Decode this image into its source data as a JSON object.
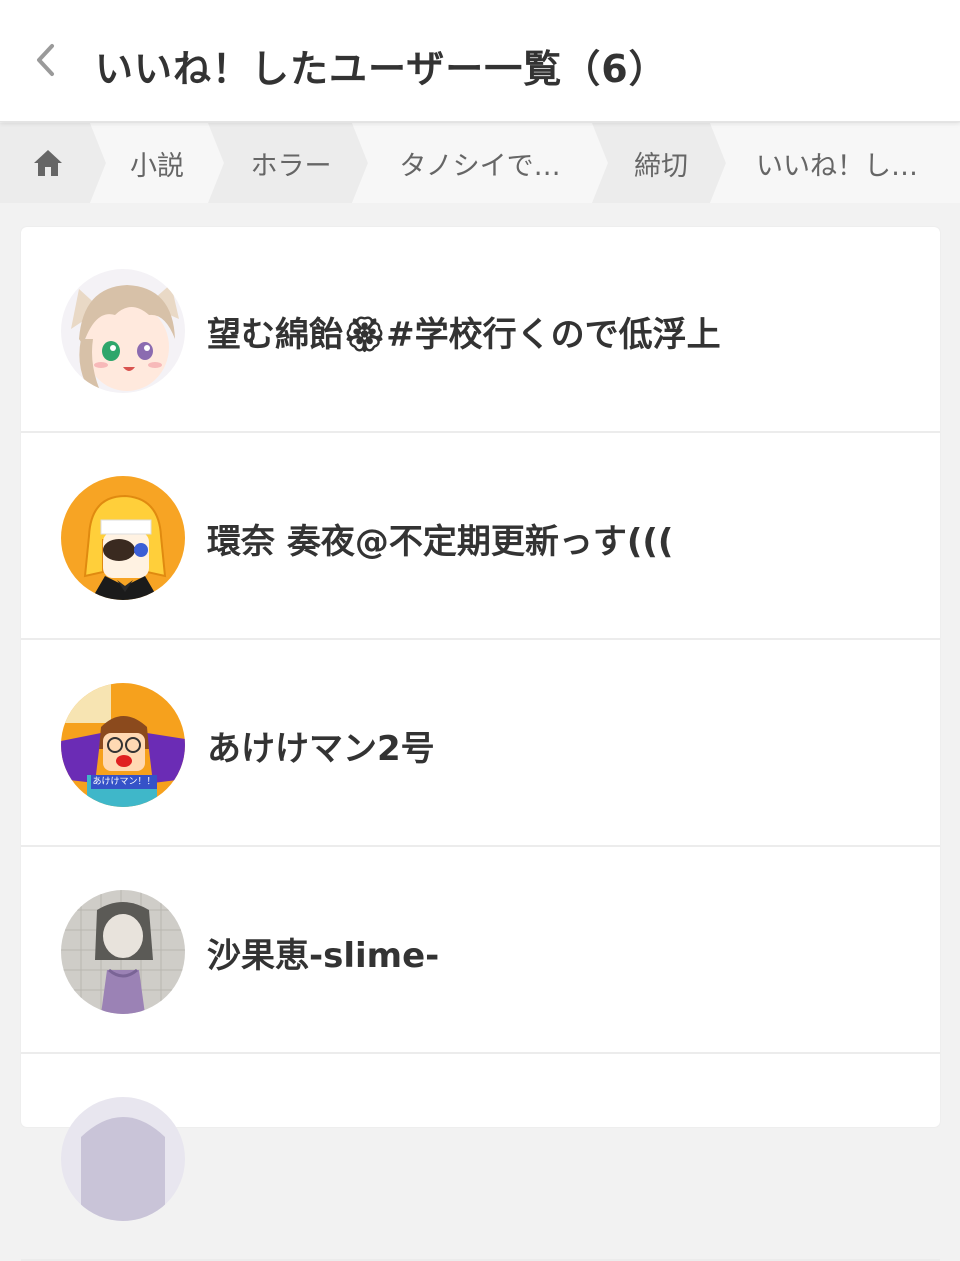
{
  "header": {
    "title": "いいね！したユーザー一覧（6）"
  },
  "breadcrumb": {
    "items": [
      {
        "label": "",
        "icon": "home-icon"
      },
      {
        "label": "小説"
      },
      {
        "label": "ホラー"
      },
      {
        "label": "タノシイで…"
      },
      {
        "label": "締切"
      },
      {
        "label": "いいね！し…"
      }
    ]
  },
  "users": [
    {
      "name": "望む綿飴🏵#学校行くので低浮上"
    },
    {
      "name": "環奈 奏夜@不定期更新っす((("
    },
    {
      "name": "あけけマン2号",
      "avatar_caption": "あけけマン！！"
    },
    {
      "name": "沙果恵-slime-"
    },
    {
      "name": ""
    }
  ],
  "colors": {
    "header_bg": "#ffffff",
    "breadcrumb_bg": "#f7f7f7",
    "breadcrumb_alt_bg": "#ececec",
    "text": "#333333",
    "muted": "#666666"
  }
}
